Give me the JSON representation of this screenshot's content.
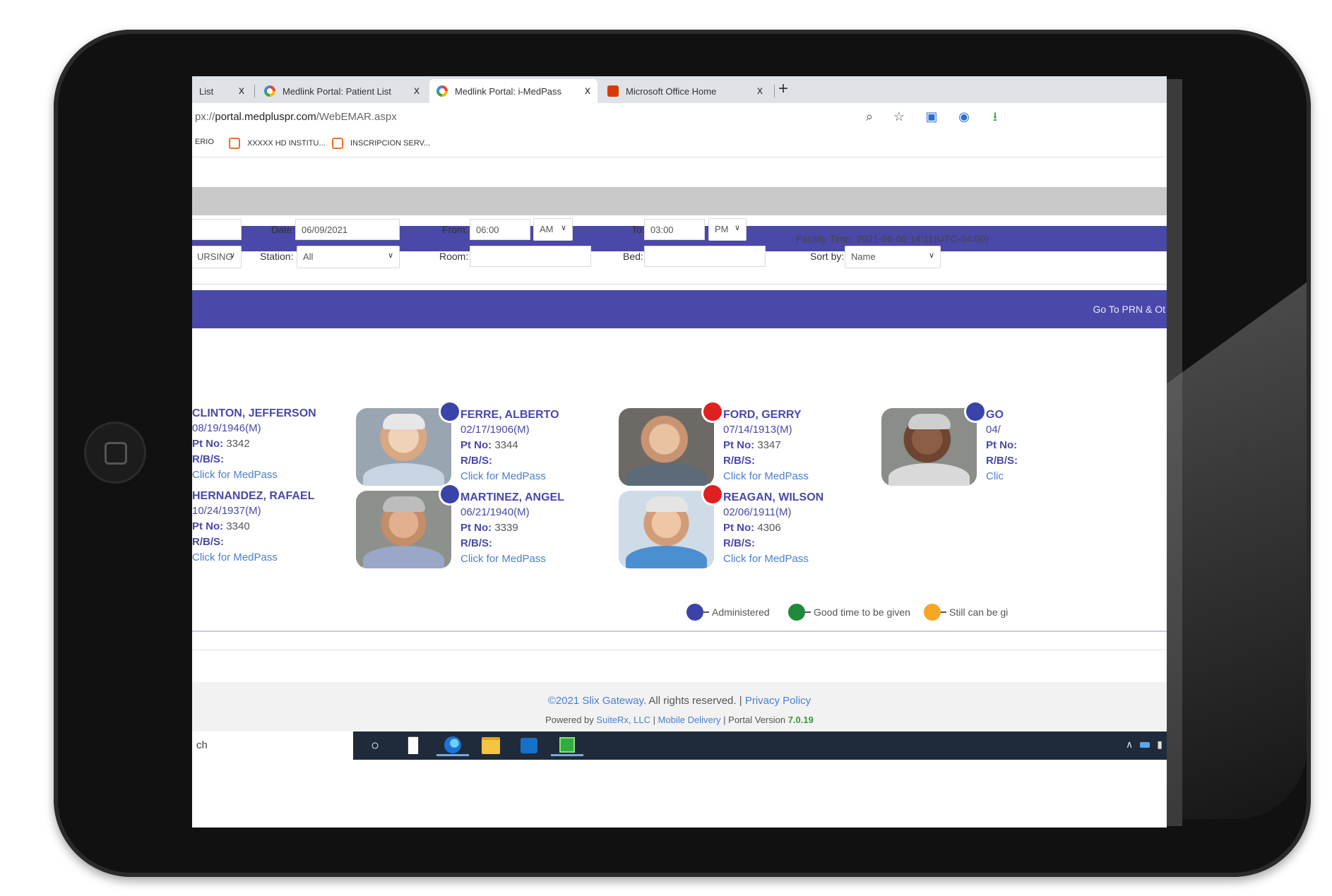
{
  "browser": {
    "tabs": [
      {
        "label": "List",
        "icon": "none"
      },
      {
        "label": "Medlink Portal: Patient List",
        "icon": "chrome-logo-icon"
      },
      {
        "label": "Medlink Portal: i-MedPass",
        "icon": "chrome-logo-icon",
        "active": true
      },
      {
        "label": "Microsoft Office Home",
        "icon": "office-logo-icon"
      }
    ],
    "close_symbol": "x",
    "new_tab_symbol": "+",
    "url_prefix": "px://",
    "url_host": "portal.medpluspr.com",
    "url_path": "/WebEMAR.aspx",
    "bookmarks": [
      "ERIO",
      "XXXXX HD INSTITU...",
      "INSCRIPCION SERV..."
    ]
  },
  "filters": {
    "date_label": "Date:",
    "date_value": "06/09/2021",
    "from_label": "From:",
    "from_time": "06:00",
    "from_ampm": "AM",
    "to_label": "To:",
    "to_time": "03:00",
    "to_ampm": "PM",
    "facility_time": "Facility Time: 2021-06-09 14:11(UTC-04:00)",
    "unit_value": "URSING",
    "station_label": "Station:",
    "station_value": "All",
    "room_label": "Room:",
    "room_value": "",
    "bed_label": "Bed:",
    "bed_value": "",
    "sort_label": "Sort by:",
    "sort_value": "Name"
  },
  "prn_link": "Go To PRN & Ot",
  "patients": [
    {
      "name": "CLINTON, JEFFERSON",
      "dob": "08/19/1946(M)",
      "pt_no": "3342",
      "rbs": "",
      "link": "Click for MedPass",
      "status": "",
      "partial": true
    },
    {
      "name": "FERRE, ALBERTO",
      "dob": "02/17/1906(M)",
      "pt_no": "3344",
      "rbs": "",
      "link": "Click for MedPass",
      "status": "Administered",
      "status_color": "#3a44a8"
    },
    {
      "name": "FORD, GERRY",
      "dob": "07/14/1913(M)",
      "pt_no": "3347",
      "rbs": "",
      "link": "Click for MedPass",
      "status_color": "#e02020"
    },
    {
      "name": "GO",
      "dob": "04/",
      "pt_no": "",
      "rbs": "",
      "link": "Clic",
      "status_color": "#3a44a8",
      "partial_right": true
    },
    {
      "name": "HERNANDEZ, RAFAEL",
      "dob": "10/24/1937(M)",
      "pt_no": "3340",
      "rbs": "",
      "link": "Click for MedPass",
      "partial": true
    },
    {
      "name": "MARTINEZ, ANGEL",
      "dob": "06/21/1940(M)",
      "pt_no": "3339",
      "rbs": "",
      "link": "Click for MedPass",
      "status_color": "#3a44a8"
    },
    {
      "name": "REAGAN, WILSON",
      "dob": "02/06/1911(M)",
      "pt_no": "4306",
      "rbs": "",
      "link": "Click for MedPass",
      "status_color": "#e02020"
    }
  ],
  "labels": {
    "pt_no": "Pt No:",
    "rbs": "R/B/S:"
  },
  "legend": [
    {
      "label": "Administered",
      "color": "#3a44a8"
    },
    {
      "label": "Good time to be given",
      "color": "#1f8a3a"
    },
    {
      "label": "Still can be gi",
      "color": "#f5a623"
    }
  ],
  "footer": {
    "copyright": "©2021 Slix Gateway.",
    "rights": "All rights reserved. |",
    "privacy": "Privacy Policy",
    "powered_by": "Powered by",
    "suiterx": "SuiteRx, LLC",
    "sep1": "|",
    "mobile": "Mobile Delivery",
    "portal_version_label": "| Portal Version",
    "version": "7.0.19"
  },
  "taskbar": {
    "search_text": "ch"
  }
}
